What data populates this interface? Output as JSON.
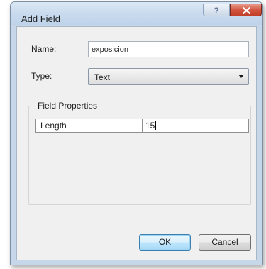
{
  "window": {
    "title": "Add Field",
    "help_label": "?"
  },
  "form": {
    "name_label": "Name:",
    "name_value": "exposicion",
    "type_label": "Type:",
    "type_value": "Text"
  },
  "field_properties": {
    "title": "Field Properties",
    "rows": [
      {
        "property": "Length",
        "value": "15"
      }
    ]
  },
  "buttons": {
    "ok": "OK",
    "cancel": "Cancel"
  },
  "colors": {
    "titlebar": "#c6d7ea",
    "close_button": "#d2553f",
    "dialog_body": "#f0f0f0",
    "default_button_accent": "#3c7fb1"
  },
  "icons": {
    "close": "close-icon",
    "dropdown": "chevron-down-icon"
  }
}
